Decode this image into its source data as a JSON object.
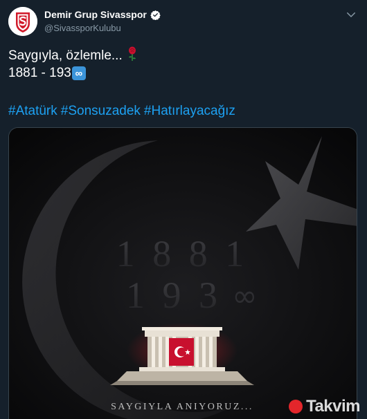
{
  "tweet": {
    "display_name": "Demir Grup Sivasspor",
    "handle": "@SivassporKulubu",
    "text_line1": "Saygıyla, özlemle...",
    "text_line1_emoji": "rose",
    "text_line2": "1881 - 193",
    "text_line2_emoji": "infinity",
    "hashtags": [
      "#Atatürk",
      "#Sonsuzadek",
      "#Hatırlayacağız"
    ]
  },
  "media": {
    "year_top": "1 8 8 1",
    "year_bottom": "1 9 3",
    "caption": "SAYGIYLA ANIYORUZ..."
  },
  "watermark": {
    "text": "Takvim"
  },
  "colors": {
    "background": "#15202b",
    "link": "#1da1f2",
    "secondary_text": "#8899a6",
    "verified_badge": "#ffffff",
    "infinity_badge": "#3b94d9"
  }
}
